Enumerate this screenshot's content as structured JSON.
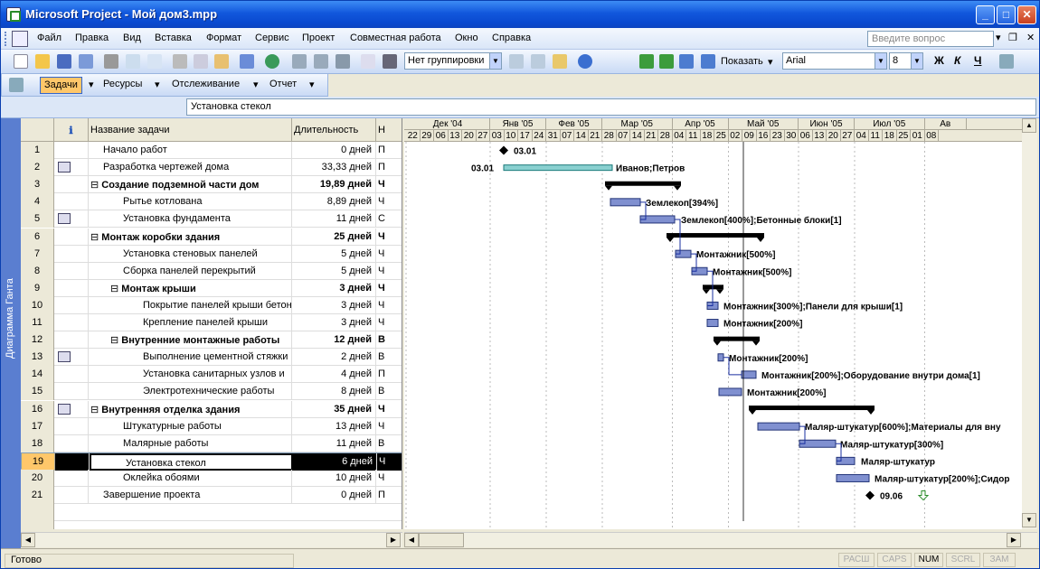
{
  "window": {
    "title": "Microsoft Project - Мой дом3.mpp"
  },
  "menu": [
    "Файл",
    "Правка",
    "Вид",
    "Вставка",
    "Формат",
    "Сервис",
    "Проект",
    "Совместная работа",
    "Окно",
    "Справка"
  ],
  "ask_placeholder": "Введите вопрос",
  "toolbar": {
    "grouping": "Нет группировки",
    "show_label": "Показать",
    "font": "Arial",
    "font_size": "8",
    "bold": "Ж",
    "italic": "К",
    "underline": "Ч"
  },
  "views": [
    "Задачи",
    "Ресурсы",
    "Отслеживание",
    "Отчет"
  ],
  "entry": "Установка стекол",
  "sidebar_label": "Диаграмма Ганта",
  "columns": {
    "name": "Название задачи",
    "duration": "Длительность",
    "start": "Н"
  },
  "tasks": [
    {
      "id": "1",
      "name": "Начало работ",
      "duration": "0 дней",
      "start": "П",
      "level": 1,
      "summary": false,
      "icon": false
    },
    {
      "id": "2",
      "name": "Разработка чертежей дома",
      "duration": "33,33 дней",
      "start": "П",
      "level": 1,
      "summary": false,
      "icon": true
    },
    {
      "id": "3",
      "name": "Создание подземной части дом",
      "duration": "19,89 дней",
      "start": "Ч",
      "level": 1,
      "summary": true,
      "icon": false
    },
    {
      "id": "4",
      "name": "Рытье котлована",
      "duration": "8,89 дней",
      "start": "Ч",
      "level": 2,
      "summary": false,
      "icon": false
    },
    {
      "id": "5",
      "name": "Установка фундамента",
      "duration": "11 дней",
      "start": "С",
      "level": 2,
      "summary": false,
      "icon": true
    },
    {
      "id": "6",
      "name": "Монтаж коробки здания",
      "duration": "25 дней",
      "start": "Ч",
      "level": 1,
      "summary": true,
      "icon": false
    },
    {
      "id": "7",
      "name": "Установка стеновых панелей",
      "duration": "5 дней",
      "start": "Ч",
      "level": 2,
      "summary": false,
      "icon": false
    },
    {
      "id": "8",
      "name": "Сборка панелей перекрытий",
      "duration": "5 дней",
      "start": "Ч",
      "level": 2,
      "summary": false,
      "icon": false
    },
    {
      "id": "9",
      "name": "Монтаж крыши",
      "duration": "3 дней",
      "start": "Ч",
      "level": 2,
      "summary": true,
      "icon": false
    },
    {
      "id": "10",
      "name": "Покрытие панелей крыши бетон",
      "duration": "3 дней",
      "start": "Ч",
      "level": 3,
      "summary": false,
      "icon": false
    },
    {
      "id": "11",
      "name": "Крепление панелей крыши",
      "duration": "3 дней",
      "start": "Ч",
      "level": 3,
      "summary": false,
      "icon": false
    },
    {
      "id": "12",
      "name": "Внутренние монтажные работы",
      "duration": "12 дней",
      "start": "В",
      "level": 2,
      "summary": true,
      "icon": false
    },
    {
      "id": "13",
      "name": "Выполнение цементной стяжки",
      "duration": "2 дней",
      "start": "В",
      "level": 3,
      "summary": false,
      "icon": true
    },
    {
      "id": "14",
      "name": "Установка санитарных узлов и",
      "duration": "4 дней",
      "start": "П",
      "level": 3,
      "summary": false,
      "icon": false
    },
    {
      "id": "15",
      "name": "Электротехнические работы",
      "duration": "8 дней",
      "start": "В",
      "level": 3,
      "summary": false,
      "icon": false
    },
    {
      "id": "16",
      "name": "Внутренняя отделка здания",
      "duration": "35 дней",
      "start": "Ч",
      "level": 1,
      "summary": true,
      "icon": true
    },
    {
      "id": "17",
      "name": "Штукатурные работы",
      "duration": "13 дней",
      "start": "Ч",
      "level": 2,
      "summary": false,
      "icon": false
    },
    {
      "id": "18",
      "name": "Малярные работы",
      "duration": "11 дней",
      "start": "В",
      "level": 2,
      "summary": false,
      "icon": false
    },
    {
      "id": "19",
      "name": "Установка стекол",
      "duration": "6 дней",
      "start": "Ч",
      "level": 2,
      "summary": false,
      "icon": false
    },
    {
      "id": "20",
      "name": "Оклейка обоями",
      "duration": "10 дней",
      "start": "Ч",
      "level": 2,
      "summary": false,
      "icon": false
    },
    {
      "id": "21",
      "name": "Завершение проекта",
      "duration": "0 дней",
      "start": "П",
      "level": 1,
      "summary": false,
      "icon": false
    }
  ],
  "timescale": {
    "months": [
      "Дек '04",
      "Янв '05",
      "Фев '05",
      "Мар '05",
      "Апр '05",
      "Май '05",
      "Июн '05",
      "Июл '05",
      "Ав"
    ],
    "weeks": [
      "22",
      "29",
      "06",
      "13",
      "20",
      "27",
      "03",
      "10",
      "17",
      "24",
      "31",
      "07",
      "14",
      "21",
      "28",
      "07",
      "14",
      "21",
      "28",
      "04",
      "11",
      "18",
      "25",
      "02",
      "09",
      "16",
      "23",
      "30",
      "06",
      "13",
      "20",
      "27",
      "04",
      "11",
      "18",
      "25",
      "01",
      "08"
    ]
  },
  "gantt_labels": {
    "r1": "03.01",
    "r2a": "03.01",
    "r2b": "Иванов;Петров",
    "r4": "Землекоп[394%]",
    "r5": "Землекоп[400%];Бетонные блоки[1]",
    "r7": "Монтажник[500%]",
    "r8": "Монтажник[500%]",
    "r10": "Монтажник[300%];Панели для крыши[1]",
    "r11": "Монтажник[200%]",
    "r13": "Монтажник[200%]",
    "r14": "Монтажник[200%];Оборудование внутри дома[1]",
    "r15": "Монтажник[200%]",
    "r17": "Маляр-штукатур[600%];Материалы для вну",
    "r18": "Маляр-штукатур[300%]",
    "r19": "Маляр-штукатур",
    "r20": "Маляр-штукатур[200%];Сидор",
    "r21": "09.06"
  },
  "status": {
    "ready": "Готово",
    "keys": [
      "РАСШ",
      "CAPS",
      "NUM",
      "SCRL",
      "ЗАМ"
    ],
    "active": "NUM"
  }
}
